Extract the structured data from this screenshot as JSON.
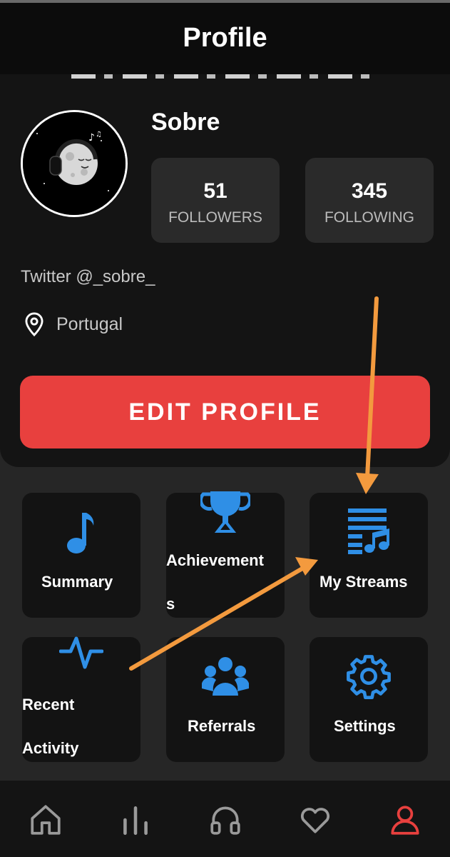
{
  "header": {
    "title": "Profile"
  },
  "profile": {
    "username": "Sobre",
    "followers": {
      "count": "51",
      "label": "FOLLOWERS"
    },
    "following": {
      "count": "345",
      "label": "FOLLOWING"
    },
    "bio": "Twitter @_sobre_",
    "location": "Portugal",
    "edit_label": "EDIT PROFILE"
  },
  "tiles": {
    "summary": "Summary",
    "achievements_line1": "Achievement",
    "achievements_line2": "s",
    "streams": "My Streams",
    "recent_line1": "Recent",
    "recent_line2": "Activity",
    "referrals": "Referrals",
    "settings": "Settings"
  },
  "colors": {
    "accent_blue": "#2f8fe6",
    "edit_red": "#e8403e",
    "annotation_orange": "#f39a3e",
    "active_tab": "#e8403e"
  },
  "icons": {
    "summary": "music-note-icon",
    "achievements": "trophy-icon",
    "streams": "playlist-icon",
    "recent": "activity-pulse-icon",
    "referrals": "group-icon",
    "settings": "gear-icon"
  },
  "tabs": [
    "home-icon",
    "stats-icon",
    "headphones-icon",
    "heart-icon",
    "user-icon"
  ]
}
